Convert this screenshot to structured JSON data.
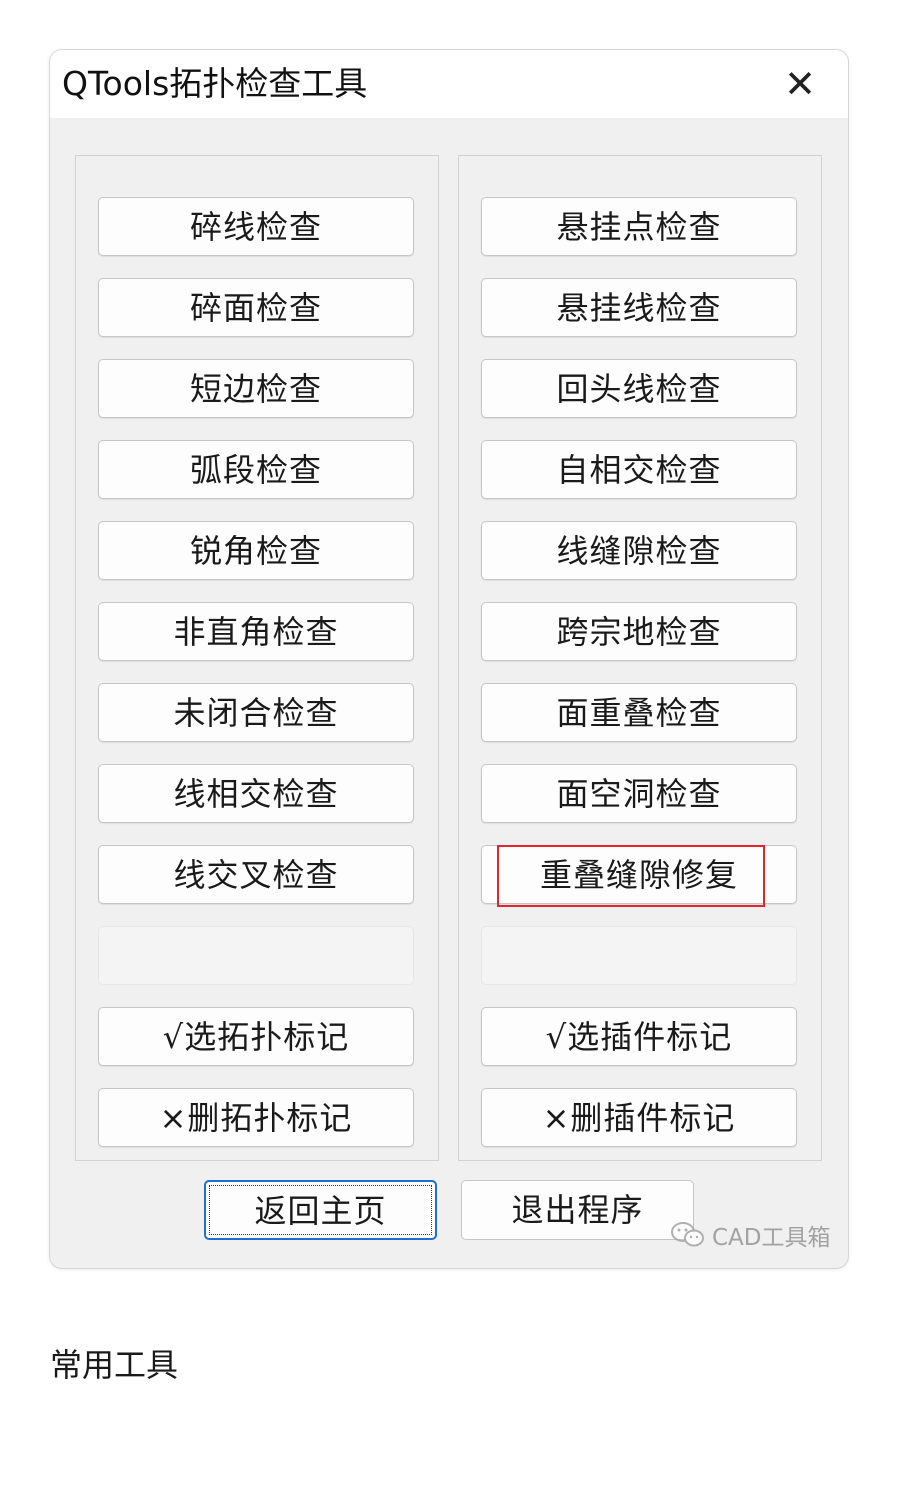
{
  "window": {
    "title": "QTools拓扑检查工具",
    "close_symbol": "✕"
  },
  "left_panel": {
    "buttons": [
      "碎线检查",
      "碎面检查",
      "短边检查",
      "弧段检查",
      "锐角检查",
      "非直角检查",
      "未闭合检查",
      "线相交检查",
      "线交叉检查",
      "",
      "√选拓扑标记",
      "×删拓扑标记"
    ]
  },
  "right_panel": {
    "buttons": [
      "悬挂点检查",
      "悬挂线检查",
      "回头线检查",
      "自相交检查",
      "线缝隙检查",
      "跨宗地检查",
      "面重叠检查",
      "面空洞检查",
      "重叠缝隙修复",
      "",
      "√选插件标记",
      "×删插件标记"
    ]
  },
  "footer": {
    "home_label": "返回主页",
    "exit_label": "退出程序"
  },
  "watermark": {
    "text": "CAD工具箱",
    "icon": "wechat-icon"
  },
  "caption": "常用工具",
  "colors": {
    "highlight": "#e0262f",
    "focus": "#1f6fd0"
  }
}
